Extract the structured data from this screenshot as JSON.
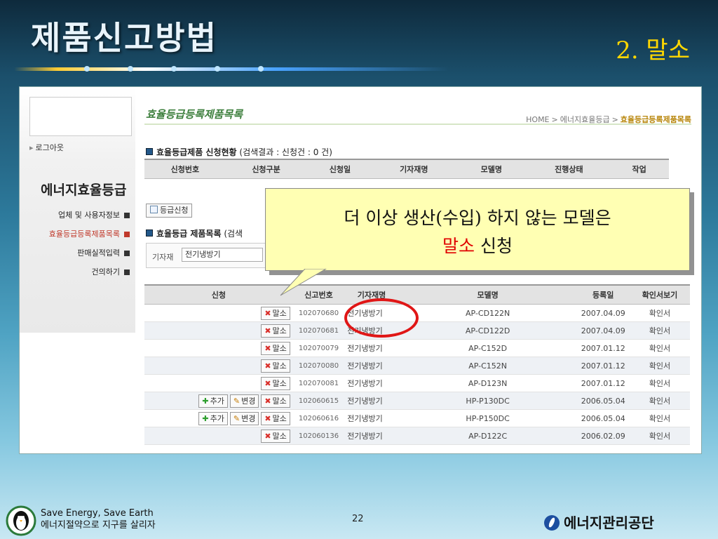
{
  "slide": {
    "title": "제품신고방법",
    "subtitle": "2. 말소",
    "page_number": "22"
  },
  "sidebar": {
    "logout": "로그아웃",
    "menu_heading": "에너지효율등급",
    "items": [
      {
        "label": "업체 및 사용자정보",
        "active": false
      },
      {
        "label": "효율등급등록제품목록",
        "active": true
      },
      {
        "label": "판매실적입력",
        "active": false
      },
      {
        "label": "건의하기",
        "active": false
      }
    ]
  },
  "main": {
    "page_title": "효율등급등록제품목록",
    "breadcrumb": [
      "HOME",
      "에너지효율등급",
      "효율등급등록제품목록"
    ],
    "section1": {
      "title": "효율등급제품 신청현황",
      "note": "(검색결과 : 신청건 : 0 건)"
    },
    "table1_headers": [
      "신청번호",
      "신청구분",
      "신청일",
      "기자재명",
      "모델명",
      "진행상태",
      "작업"
    ],
    "register_button": "등급신청",
    "section2": {
      "title": "효율등급 제품목록",
      "note": "(검색"
    },
    "filter": {
      "label": "기자재",
      "value": "전기냉방기"
    },
    "table2_headers": [
      "신청",
      "신고번호",
      "기자재명",
      "모델명",
      "등록일",
      "확인서보기"
    ],
    "buttons": {
      "add": "추가",
      "edit": "변경",
      "cancel": "말소"
    },
    "rows": [
      {
        "no": "102070680",
        "cat": "전기냉방기",
        "model": "AP-CD122N",
        "date": "2007.04.09",
        "cert": "확인서",
        "extra": false
      },
      {
        "no": "102070681",
        "cat": "전기냉방기",
        "model": "AP-CD122D",
        "date": "2007.04.09",
        "cert": "확인서",
        "extra": false
      },
      {
        "no": "102070079",
        "cat": "전기냉방기",
        "model": "AP-C152D",
        "date": "2007.01.12",
        "cert": "확인서",
        "extra": false
      },
      {
        "no": "102070080",
        "cat": "전기냉방기",
        "model": "AP-C152N",
        "date": "2007.01.12",
        "cert": "확인서",
        "extra": false
      },
      {
        "no": "102070081",
        "cat": "전기냉방기",
        "model": "AP-D123N",
        "date": "2007.01.12",
        "cert": "확인서",
        "extra": false
      },
      {
        "no": "102060615",
        "cat": "전기냉방기",
        "model": "HP-P130DC",
        "date": "2006.05.04",
        "cert": "확인서",
        "extra": true
      },
      {
        "no": "102060616",
        "cat": "전기냉방기",
        "model": "HP-P150DC",
        "date": "2006.05.04",
        "cert": "확인서",
        "extra": true
      },
      {
        "no": "102060136",
        "cat": "전기냉방기",
        "model": "AP-D122C",
        "date": "2006.02.09",
        "cert": "확인서",
        "extra": false
      }
    ]
  },
  "callout": {
    "line1": "더 이상 생산(수입) 하지 않는 모델은",
    "line2_highlight": "말소",
    "line2_rest": " 신청",
    "highlight_color": "#e00000"
  },
  "footer": {
    "line1": "Save Energy, Save Earth",
    "line2": "에너지절약으로 지구를 살리자",
    "org": "에너지관리공단"
  },
  "colors": {
    "accent_green": "#3d7f3d",
    "title_gold": "#ffd700",
    "ring_red": "#e01616",
    "callout_bg": "#ffffb3"
  }
}
